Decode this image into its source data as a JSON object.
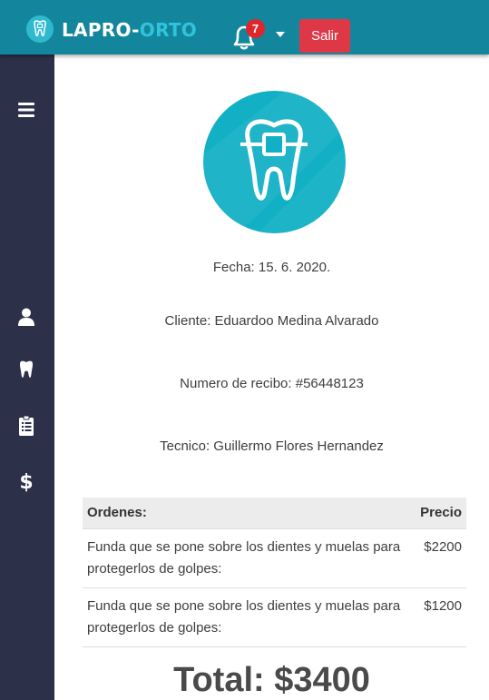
{
  "header": {
    "logo_prefix": "LAPRO-",
    "logo_suffix": "ORTO",
    "notification_count": "7",
    "logout_label": "Salir"
  },
  "sidebar": {
    "items": [
      {
        "icon": "menu-icon"
      },
      {
        "icon": "user-icon"
      },
      {
        "icon": "tooth-icon"
      },
      {
        "icon": "clipboard-icon"
      },
      {
        "icon": "dollar-icon"
      }
    ]
  },
  "receipt": {
    "date": "Fecha: 15. 6. 2020.",
    "client": "Cliente: Eduardoo Medina Alvarado",
    "number": "Numero de recibo: #56448123",
    "technician": "Tecnico: Guillermo Flores Hernandez",
    "table": {
      "headers": [
        "Ordenes:",
        "Precio"
      ],
      "rows": [
        [
          "Funda que se pone sobre los dientes y muelas para protegerlos de golpes:",
          "$2200"
        ],
        [
          "Funda que se pone sobre los dientes y muelas para protegerlos de golpes:",
          "$1200"
        ]
      ]
    },
    "total": "Total: $3400"
  },
  "colors": {
    "header": "#13869d",
    "sidebar": "#2c3049",
    "accent": "#12b0c4",
    "logout": "#de3847",
    "badge": "#e0262d"
  }
}
